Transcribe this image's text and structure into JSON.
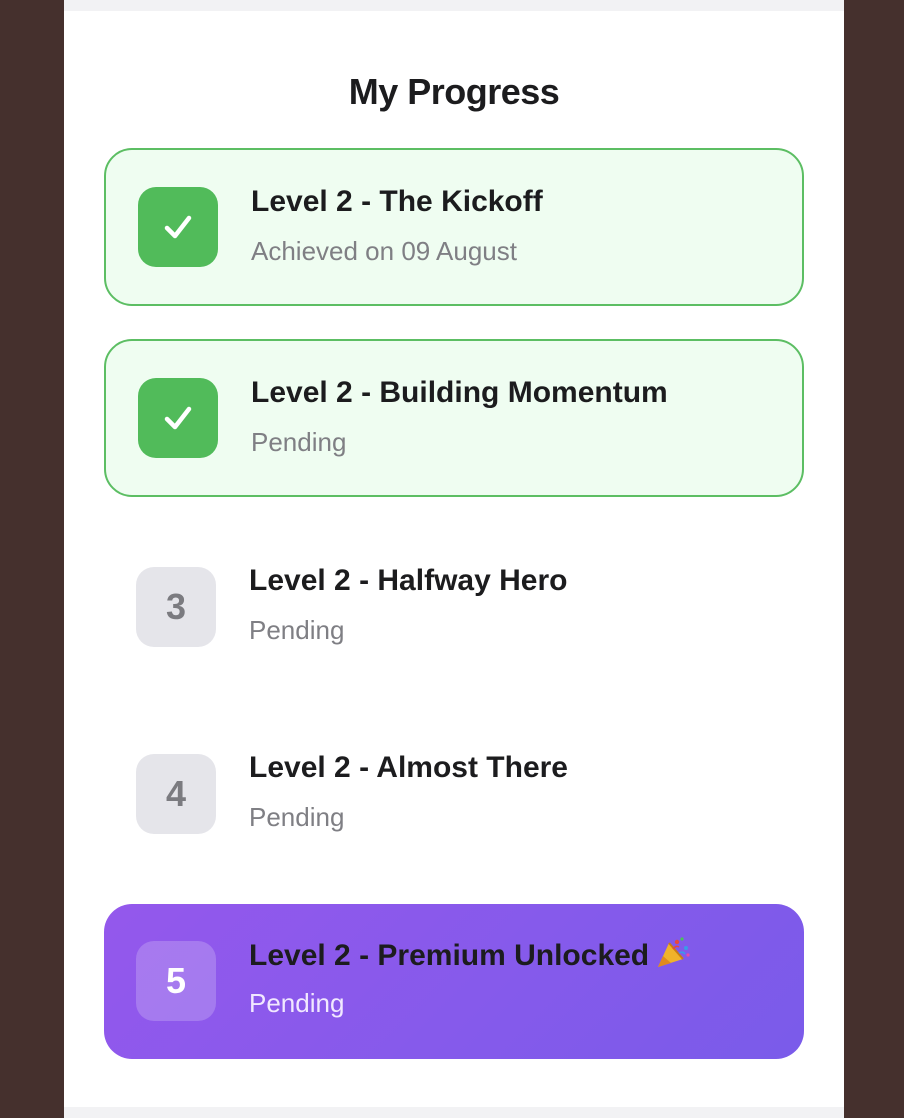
{
  "progress": {
    "title": "My Progress",
    "levels": [
      {
        "badge_icon": "checkmark-icon",
        "title": "Level 2 - The Kickoff",
        "status": "Achieved on 09 August",
        "state": "completed"
      },
      {
        "badge_icon": "checkmark-icon",
        "title": "Level 2 - Building Momentum",
        "status": "Pending",
        "state": "completed"
      },
      {
        "badge_number": "3",
        "title": "Level 2 - Halfway Hero",
        "status": "Pending",
        "state": "locked"
      },
      {
        "badge_number": "4",
        "title": "Level 2 - Almost There",
        "status": "Pending",
        "state": "locked"
      },
      {
        "badge_number": "5",
        "title": "Level 2 - Premium Unlocked",
        "title_icon": "party-popper-icon",
        "status": "Pending",
        "state": "premium"
      }
    ]
  },
  "colors": {
    "background": "#45302d",
    "completed_fill": "#effdf1",
    "completed_border": "#5cbe63",
    "check_badge": "#51bb5a",
    "locked_badge": "#e5e5ea",
    "premium_gradient_start": "#9458ec",
    "premium_gradient_end": "#7a5bea"
  }
}
